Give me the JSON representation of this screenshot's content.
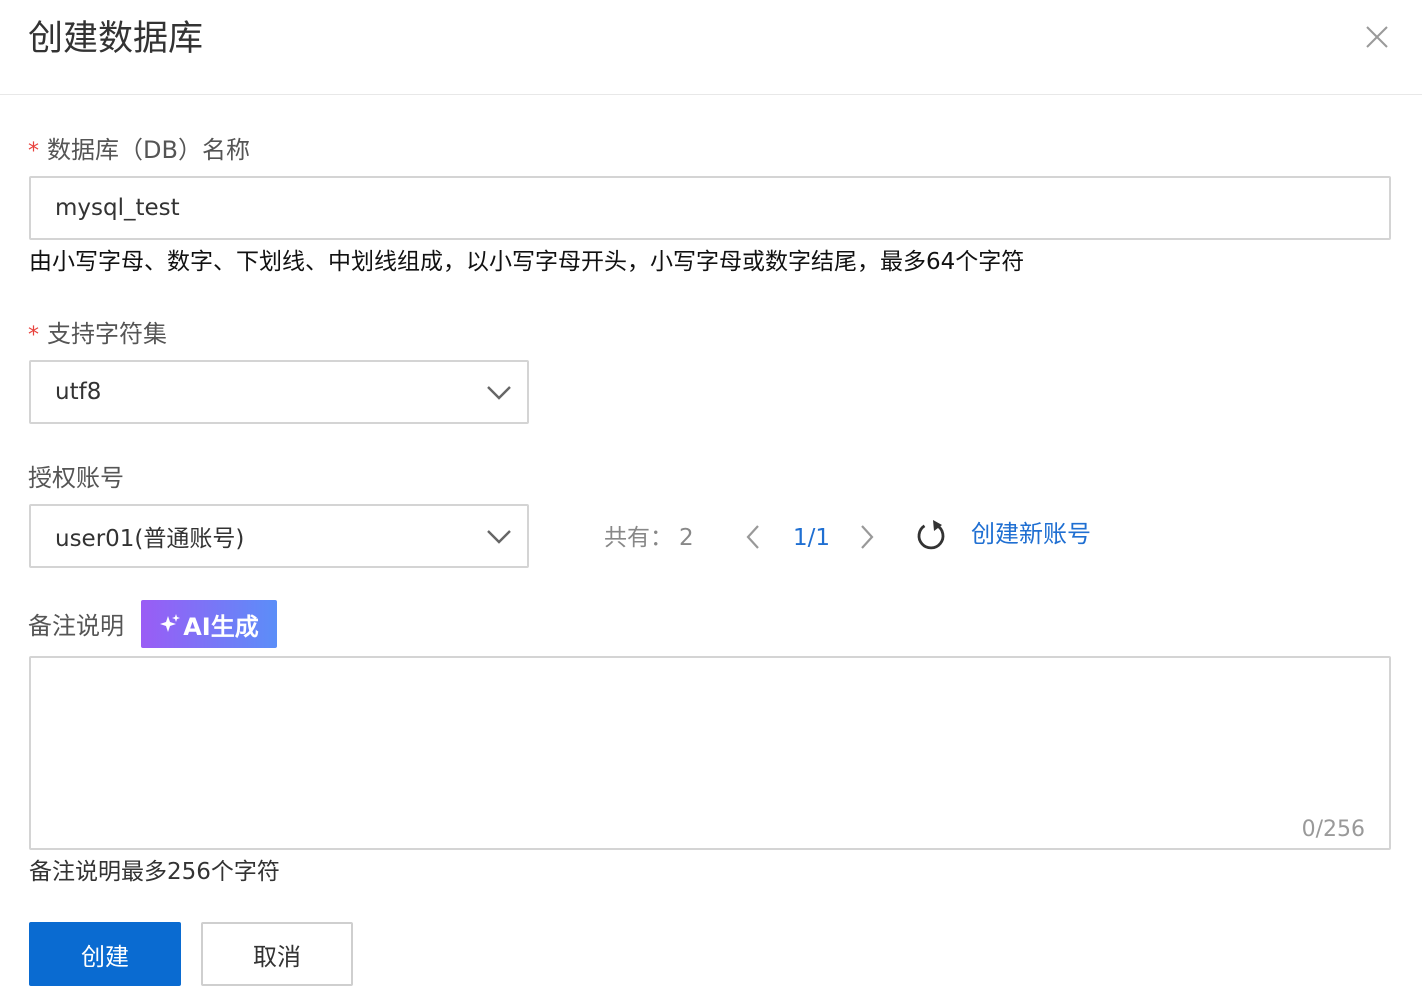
{
  "dialog": {
    "title": "创建数据库",
    "close_icon": "close-icon"
  },
  "form": {
    "db_name": {
      "required_mark": "*",
      "label": "数据库（DB）名称",
      "value": "mysql_test",
      "hint": "由小写字母、数字、下划线、中划线组成，以小写字母开头，小写字母或数字结尾，最多64个字符"
    },
    "charset": {
      "required_mark": "*",
      "label": "支持字符集",
      "value": "utf8",
      "icon": "chevron-down-icon"
    },
    "account": {
      "label": "授权账号",
      "value": "user01(普通账号)",
      "icon": "chevron-down-icon",
      "total_label": "共有：",
      "total": "2",
      "page": "1/1",
      "prev_icon": "chevron-left-icon",
      "next_icon": "chevron-right-icon",
      "refresh_icon": "refresh-icon",
      "create_link": "创建新账号"
    },
    "remark": {
      "label": "备注说明",
      "ai_button": "AI生成",
      "ai_icon": "sparkle-icon",
      "value": "",
      "counter": "0/256",
      "hint": "备注说明最多256个字符"
    }
  },
  "footer": {
    "create_button": "创建",
    "cancel_button": "取消"
  },
  "colors": {
    "primary": "#0a6bd1",
    "link": "#1f6fd2",
    "required": "#e8423d",
    "ai_gradient_start": "#9a5cf5",
    "ai_gradient_end": "#5b8ef8"
  }
}
